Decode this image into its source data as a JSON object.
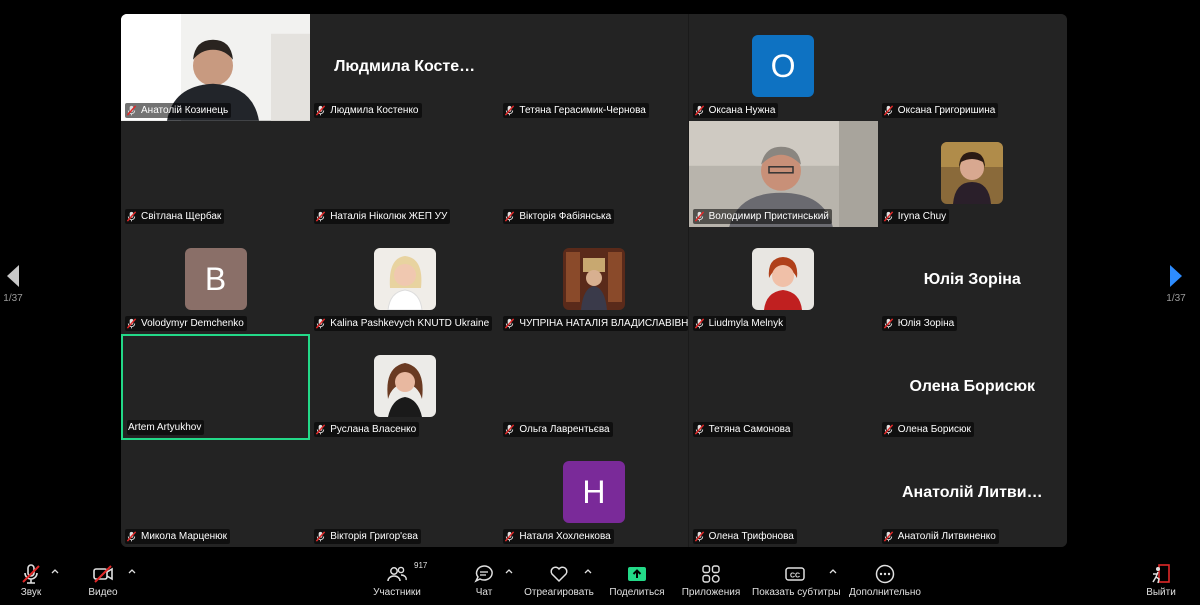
{
  "participants": [
    {
      "name": "Анатолій Козинець",
      "type": "video",
      "video": "man"
    },
    {
      "name": "Людмила Костенко",
      "type": "name",
      "big": "Людмила  Косте…"
    },
    {
      "name": "Тетяна Герасимик-Чернова",
      "type": "blank"
    },
    {
      "name": "Оксана Нужна",
      "type": "avatar",
      "letter": "O",
      "color": "#0e72c2"
    },
    {
      "name": "Оксана Григоришина",
      "type": "blank"
    },
    {
      "name": "Світлана Щербак",
      "type": "blank"
    },
    {
      "name": "Наталія Ніколюк  ЖЕП УУ",
      "type": "blank"
    },
    {
      "name": "Вікторія Фабіянська",
      "type": "blank"
    },
    {
      "name": "Володимир Пристинський",
      "type": "video",
      "video": "older"
    },
    {
      "name": "Iryna Chuy",
      "type": "photo",
      "photo": "woman-dark"
    },
    {
      "name": "Volodymyr Demchenko",
      "type": "avatar",
      "letter": "B",
      "color": "#8a6f68"
    },
    {
      "name": "Kalina Pashkevych KNUTD Ukraine",
      "type": "photo",
      "photo": "woman-blonde"
    },
    {
      "name": "ЧУПРІНА НАТАЛІЯ ВЛАДИСЛАВІВНА",
      "type": "photo",
      "photo": "library"
    },
    {
      "name": "Liudmyla Melnyk",
      "type": "photo",
      "photo": "woman-red"
    },
    {
      "name": "Юлія Зоріна",
      "type": "name",
      "big": "Юлія Зоріна"
    },
    {
      "name": "Artem Artyukhov",
      "type": "active",
      "nomic": true
    },
    {
      "name": "Руслана Власенко",
      "type": "photo",
      "photo": "woman-brunette"
    },
    {
      "name": "Ольга Лаврентьєва",
      "type": "blank"
    },
    {
      "name": "Тетяна Самонова",
      "type": "blank"
    },
    {
      "name": "Олена Борисюк",
      "type": "name",
      "big": "Олена Борисюк"
    },
    {
      "name": "Микола Марценюк",
      "type": "blank"
    },
    {
      "name": "Вікторія Григор'єва",
      "type": "blank"
    },
    {
      "name": "Наталя Хохленкова",
      "type": "avatar",
      "letter": "H",
      "color": "#7a2a99"
    },
    {
      "name": "Олена Трифонова",
      "type": "blank"
    },
    {
      "name": "Анатолій Литвиненко",
      "type": "name",
      "big": "Анатолій Литви…"
    }
  ],
  "pagination": {
    "left": "1/37",
    "right": "1/37"
  },
  "toolbar": {
    "audio": "Звук",
    "video": "Видео",
    "participants": "Участники",
    "participants_count": "917",
    "chat": "Чат",
    "react": "Отреагировать",
    "share": "Поделиться",
    "apps": "Приложения",
    "captions": "Показать субтитры",
    "more": "Дополнительно",
    "leave": "Выйти"
  },
  "colors": {
    "accent": "#23d988",
    "share": "#23d988",
    "leave": "#e02828",
    "muted": "#e02828",
    "nav": "#2d8cff"
  }
}
